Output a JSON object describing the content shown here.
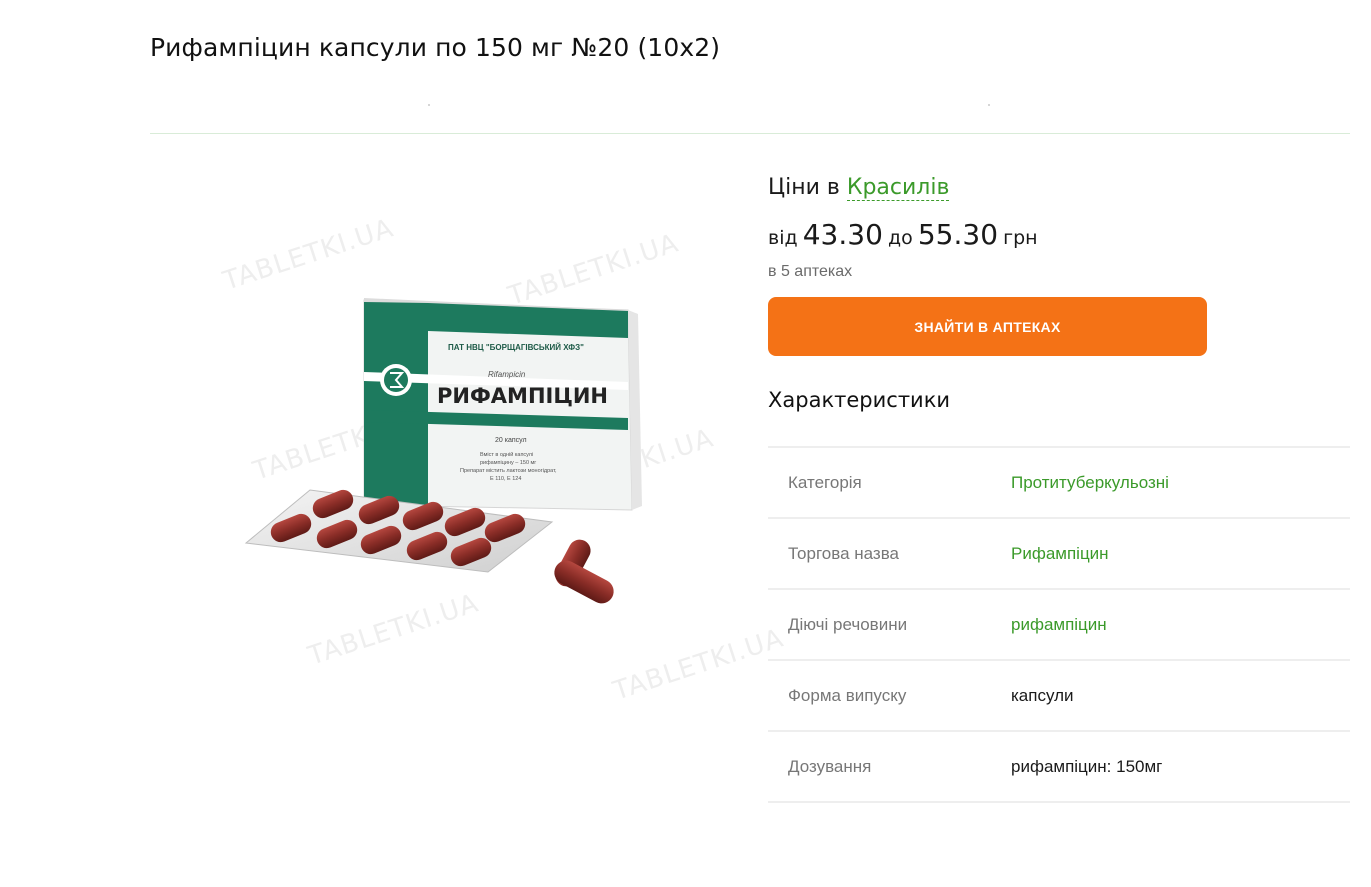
{
  "product": {
    "title": "Рифампіцин капсули по 150 мг №20 (10х2)"
  },
  "image": {
    "watermark": "TABLETKI.UA",
    "box_maker": "ПАТ НВЦ \"БОРЩАГІВСЬКИЙ ХФЗ\"",
    "box_latin": "Rifampicin",
    "box_name": "РИФАМПІЦИН",
    "box_count": "20 капсул",
    "box_composition": [
      "Вміст в одній капсулі",
      "рифампіцину – 150 мг",
      "Препарат містить лактози моногідрат,",
      "Е 110, Е 124"
    ]
  },
  "prices": {
    "heading_prefix": "Ціни в",
    "city": "Красилів",
    "from_label": "від",
    "min_price": "43.30",
    "to_label": "до",
    "max_price": "55.30",
    "currency": "грн",
    "pharmacies": "в 5 аптеках",
    "button_label": "ЗНАЙТИ В АПТЕКАХ"
  },
  "characteristics": {
    "title": "Характеристики",
    "rows": [
      {
        "key": "Категорія",
        "value": "Протитуберкульозні"
      },
      {
        "key": "Торгова назва",
        "value": "Рифампіцин"
      },
      {
        "key": "Діючі речовини",
        "value": "рифампіцин"
      },
      {
        "key": "Форма випуску",
        "value": "капсули"
      },
      {
        "key": "Дозування",
        "value": "рифампіцин: 150мг"
      }
    ]
  },
  "colors": {
    "accent_green": "#3b9a2a",
    "button_orange": "#f47216",
    "box_green": "#1d7a5e"
  }
}
